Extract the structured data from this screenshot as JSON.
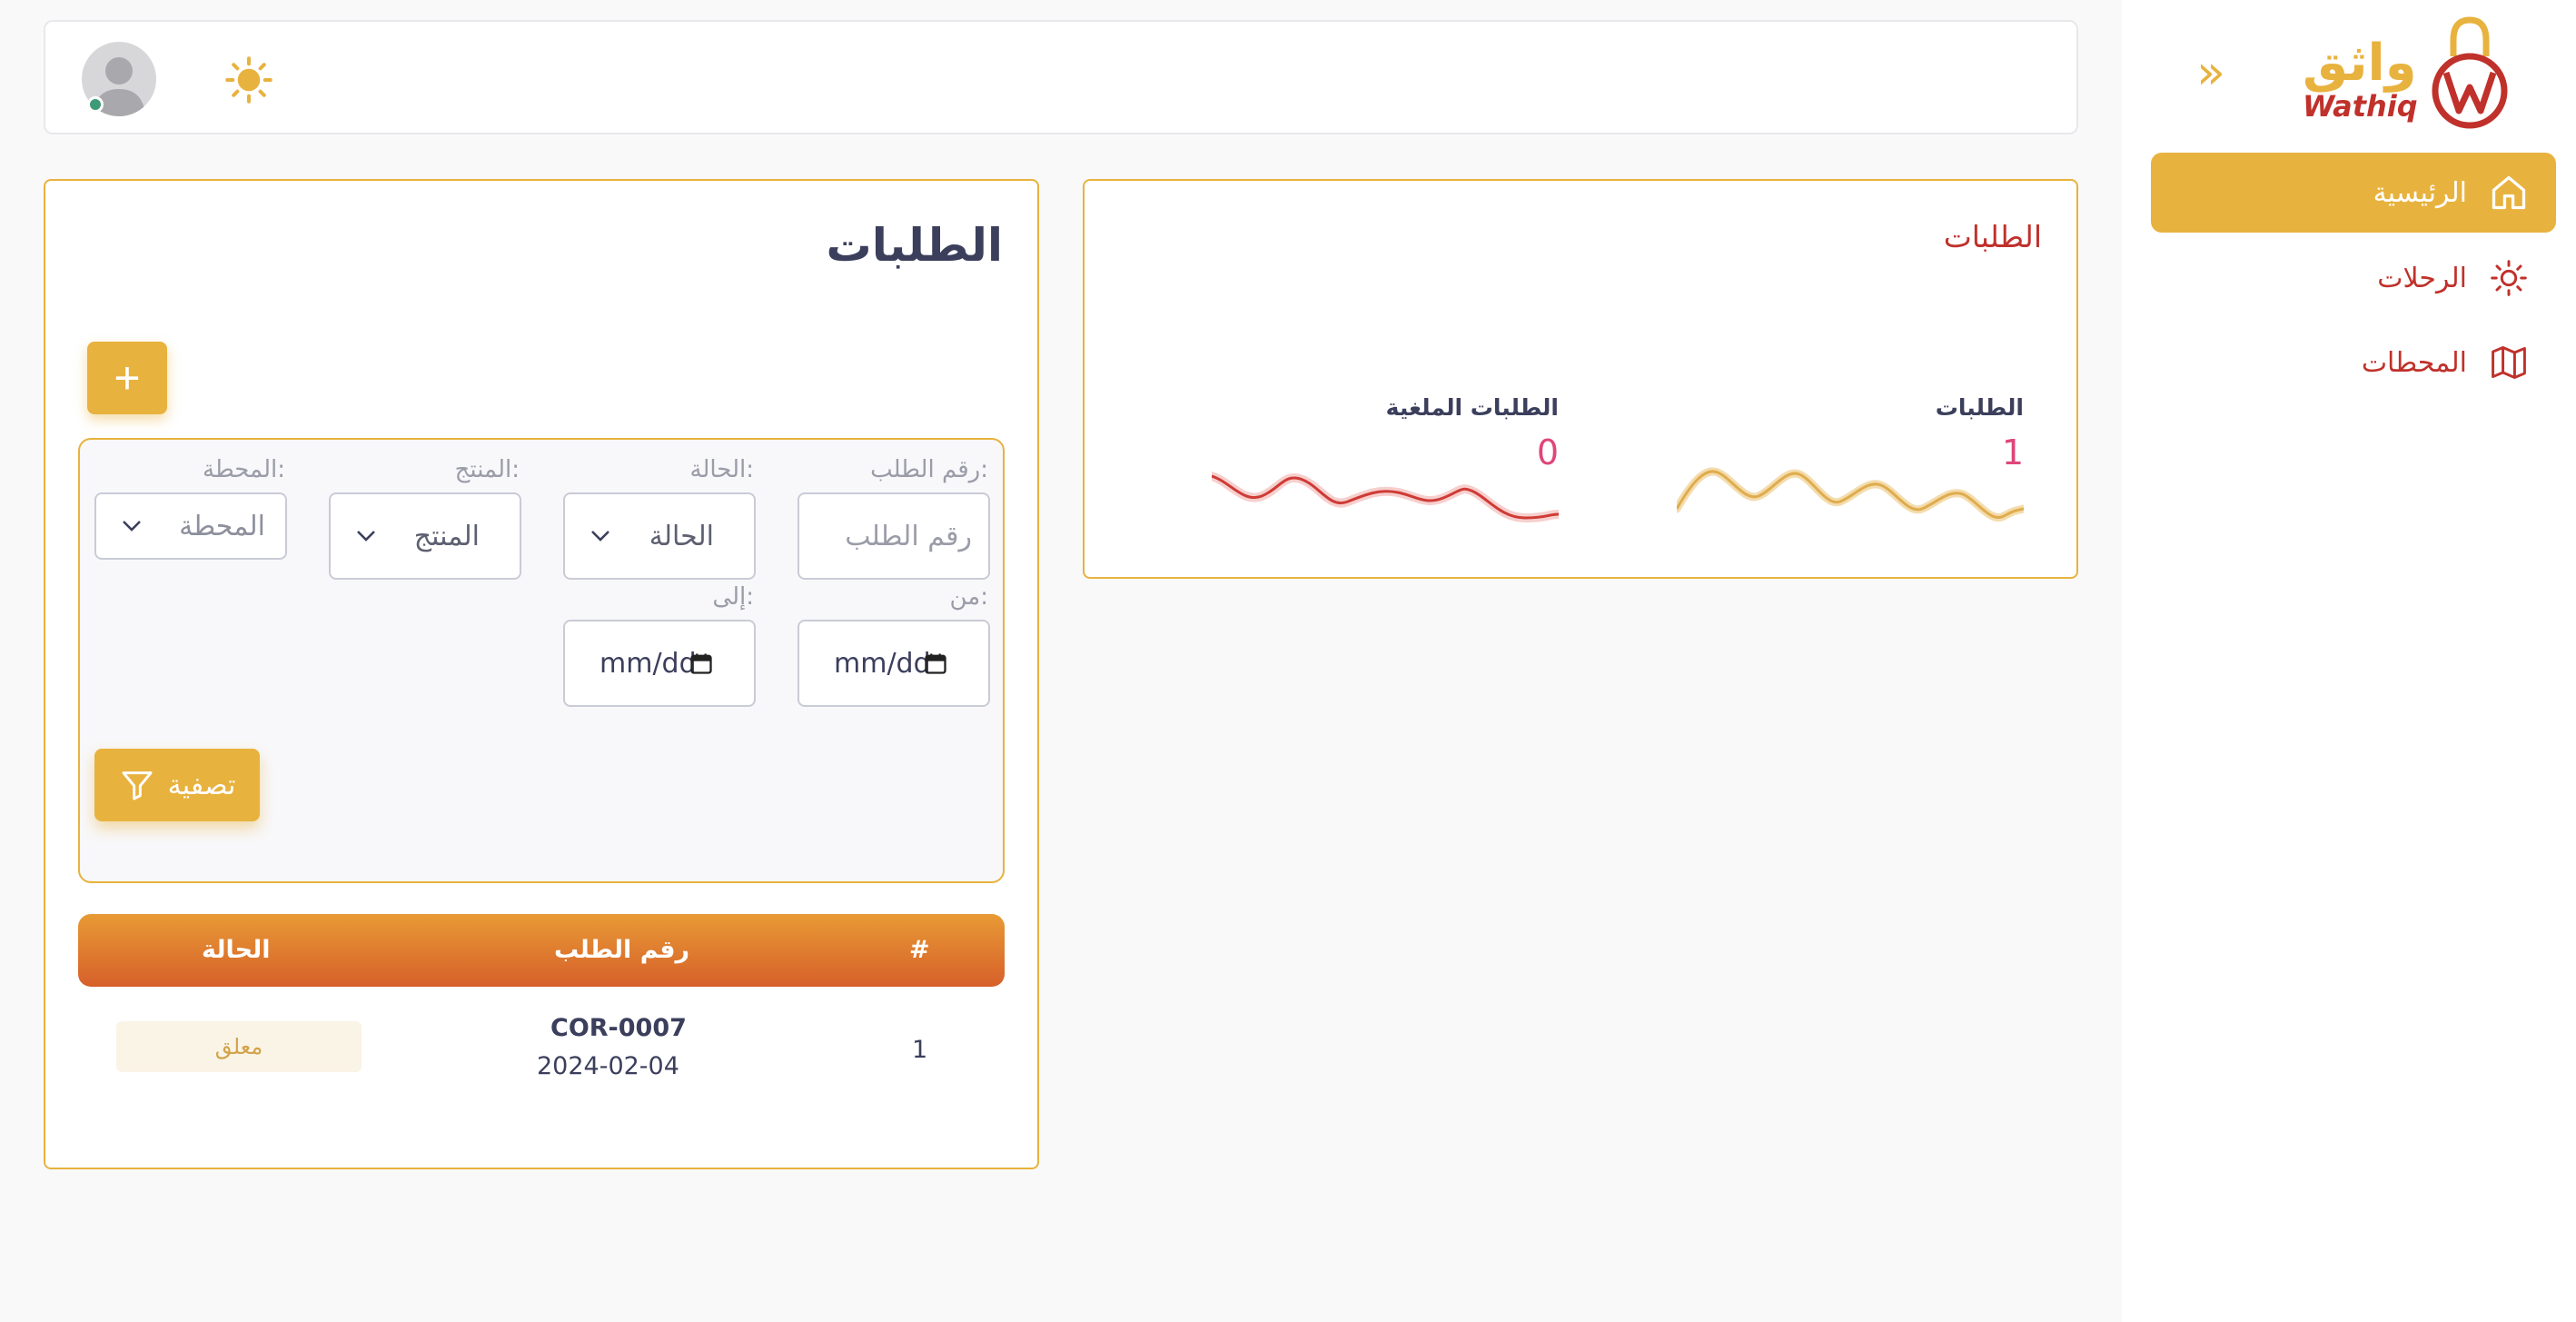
{
  "brand": {
    "name_ar": "واثق",
    "name_en": "Wathiq"
  },
  "colors": {
    "accent": "#e8b23e",
    "brand_red": "#c0312b",
    "value_pink": "#e0457b"
  },
  "sidebar": {
    "collapse_icon": "»",
    "items": [
      {
        "label": "الرئيسية",
        "icon": "home-icon",
        "active": true
      },
      {
        "label": "الرحلات",
        "icon": "sun-icon",
        "active": false
      },
      {
        "label": "المحطات",
        "icon": "map-icon",
        "active": false
      }
    ]
  },
  "topbar": {
    "theme_icon": "sun-icon",
    "avatar_icon": "user-avatar-icon",
    "online": true
  },
  "stats": {
    "title": "الطلبات",
    "items": [
      {
        "label": "الطلبات",
        "value": "1"
      },
      {
        "label": "الطلبات الملغية",
        "value": "0"
      }
    ]
  },
  "orders": {
    "title": "الطلبات",
    "add_label": "+",
    "filters": {
      "order_no_label": "رقم الطلب:",
      "order_no_placeholder": "رقم الطلب",
      "status_label": "الحالة:",
      "status_value": "الحالة",
      "product_label": "المنتج:",
      "product_value": "المنتج",
      "station_label": "المحطة:",
      "station_value": "المحطة",
      "from_label": "من:",
      "from_value": "mm/dd",
      "to_label": "إلى:",
      "to_value": "mm/dd",
      "submit_label": "تصفية"
    },
    "table": {
      "headers": [
        "#",
        "رقم الطلب",
        "الحالة"
      ],
      "rows": [
        {
          "index": "1",
          "order_no": "COR-0007",
          "date": "2024-02-04",
          "status": "معلق"
        }
      ]
    }
  }
}
